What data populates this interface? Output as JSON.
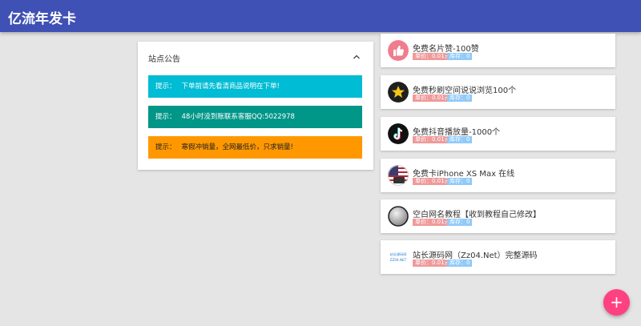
{
  "header": {
    "title": "亿流年发卡"
  },
  "notice": {
    "title": "站点公告",
    "tips": [
      {
        "prefix": "提示：",
        "text": "下单前请先看清商品说明在下单!"
      },
      {
        "prefix": "提示：",
        "text": "48小时没到账联系客服QQ:5022978"
      },
      {
        "prefix": "提示：",
        "text": "寒假冲销量，全网最低价，只求销量!"
      }
    ]
  },
  "products": [
    {
      "name": "免费名片赞-100赞",
      "price": "单价：0.01元",
      "stock": "库存：0",
      "icon": "thumbs-up-icon"
    },
    {
      "name": "免费秒刷空间说说浏览100个",
      "price": "单价：0.01元",
      "stock": "库存：0",
      "icon": "star-icon"
    },
    {
      "name": "免费抖音播放量-1000个",
      "price": "单价：0.01元",
      "stock": "库存：0",
      "icon": "tiktok-icon"
    },
    {
      "name": "免费卡iPhone XS Max 在线",
      "price": "单价：0.01元",
      "stock": "库存：0",
      "icon": "flag-icon"
    },
    {
      "name": "空白网名教程【收到教程自己修改】",
      "price": "单价：0.01元",
      "stock": "库存：0",
      "icon": "blank-circle-icon"
    },
    {
      "name": "站长源码网（Zz04.Net）完整源码",
      "price": "单价：0.01元",
      "stock": "库存：0",
      "icon": "source-logo-icon",
      "logo_text": [
        "站长源码网",
        "ZZ04.NET"
      ]
    }
  ],
  "fab": {
    "label": "+"
  },
  "colors": {
    "header": "#3f51b5",
    "tip1": "#00bcd4",
    "tip2": "#009688",
    "tip3": "#ff9800",
    "price_badge": "#ef9a9a",
    "stock_badge": "#90caf9",
    "fab": "#ff4081"
  }
}
